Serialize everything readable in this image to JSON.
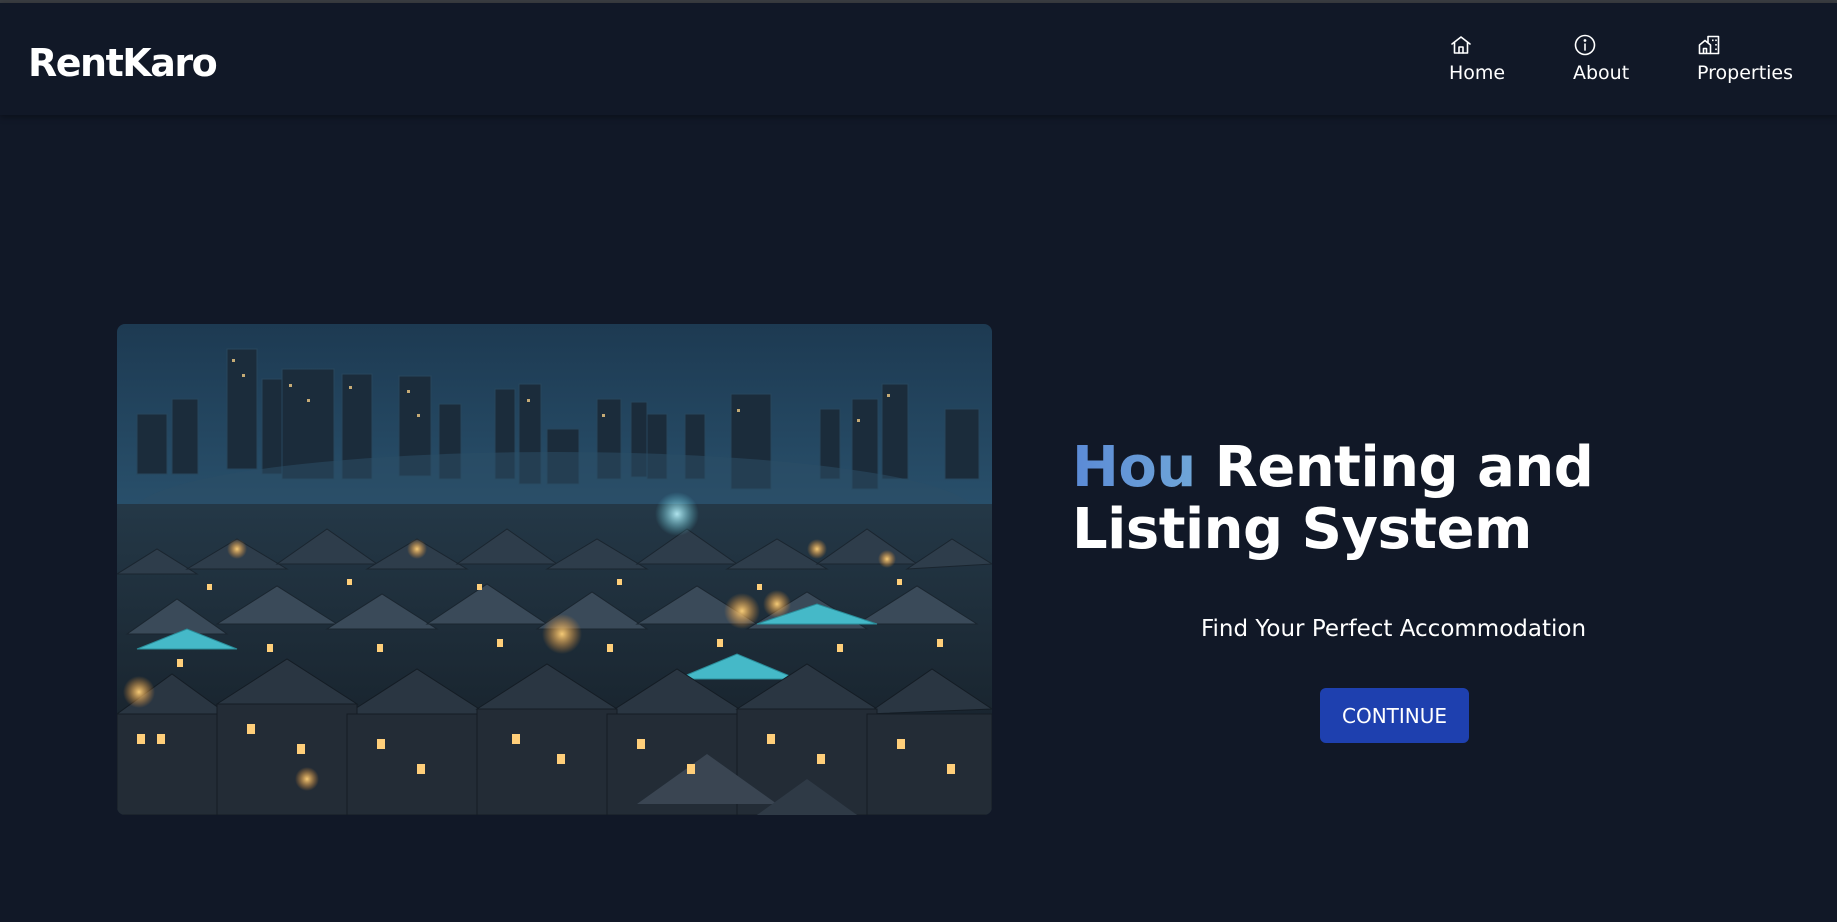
{
  "brand": {
    "name": "RentKaro"
  },
  "nav": {
    "items": [
      {
        "label": "Home",
        "icon": "home-icon"
      },
      {
        "label": "About",
        "icon": "info-icon"
      },
      {
        "label": "Properties",
        "icon": "buildings-icon"
      }
    ]
  },
  "hero": {
    "image_alt": "night cityscape with illuminated houses and skyline",
    "title_accent": "Hou",
    "title_rest": " Renting and Listing System",
    "subtitle": "Find Your Perfect Accommodation",
    "cta_label": "CONTINUE"
  },
  "colors": {
    "background": "#111827",
    "accent_text": "#5b8ad6",
    "button": "#1e40af",
    "text": "#ffffff"
  }
}
